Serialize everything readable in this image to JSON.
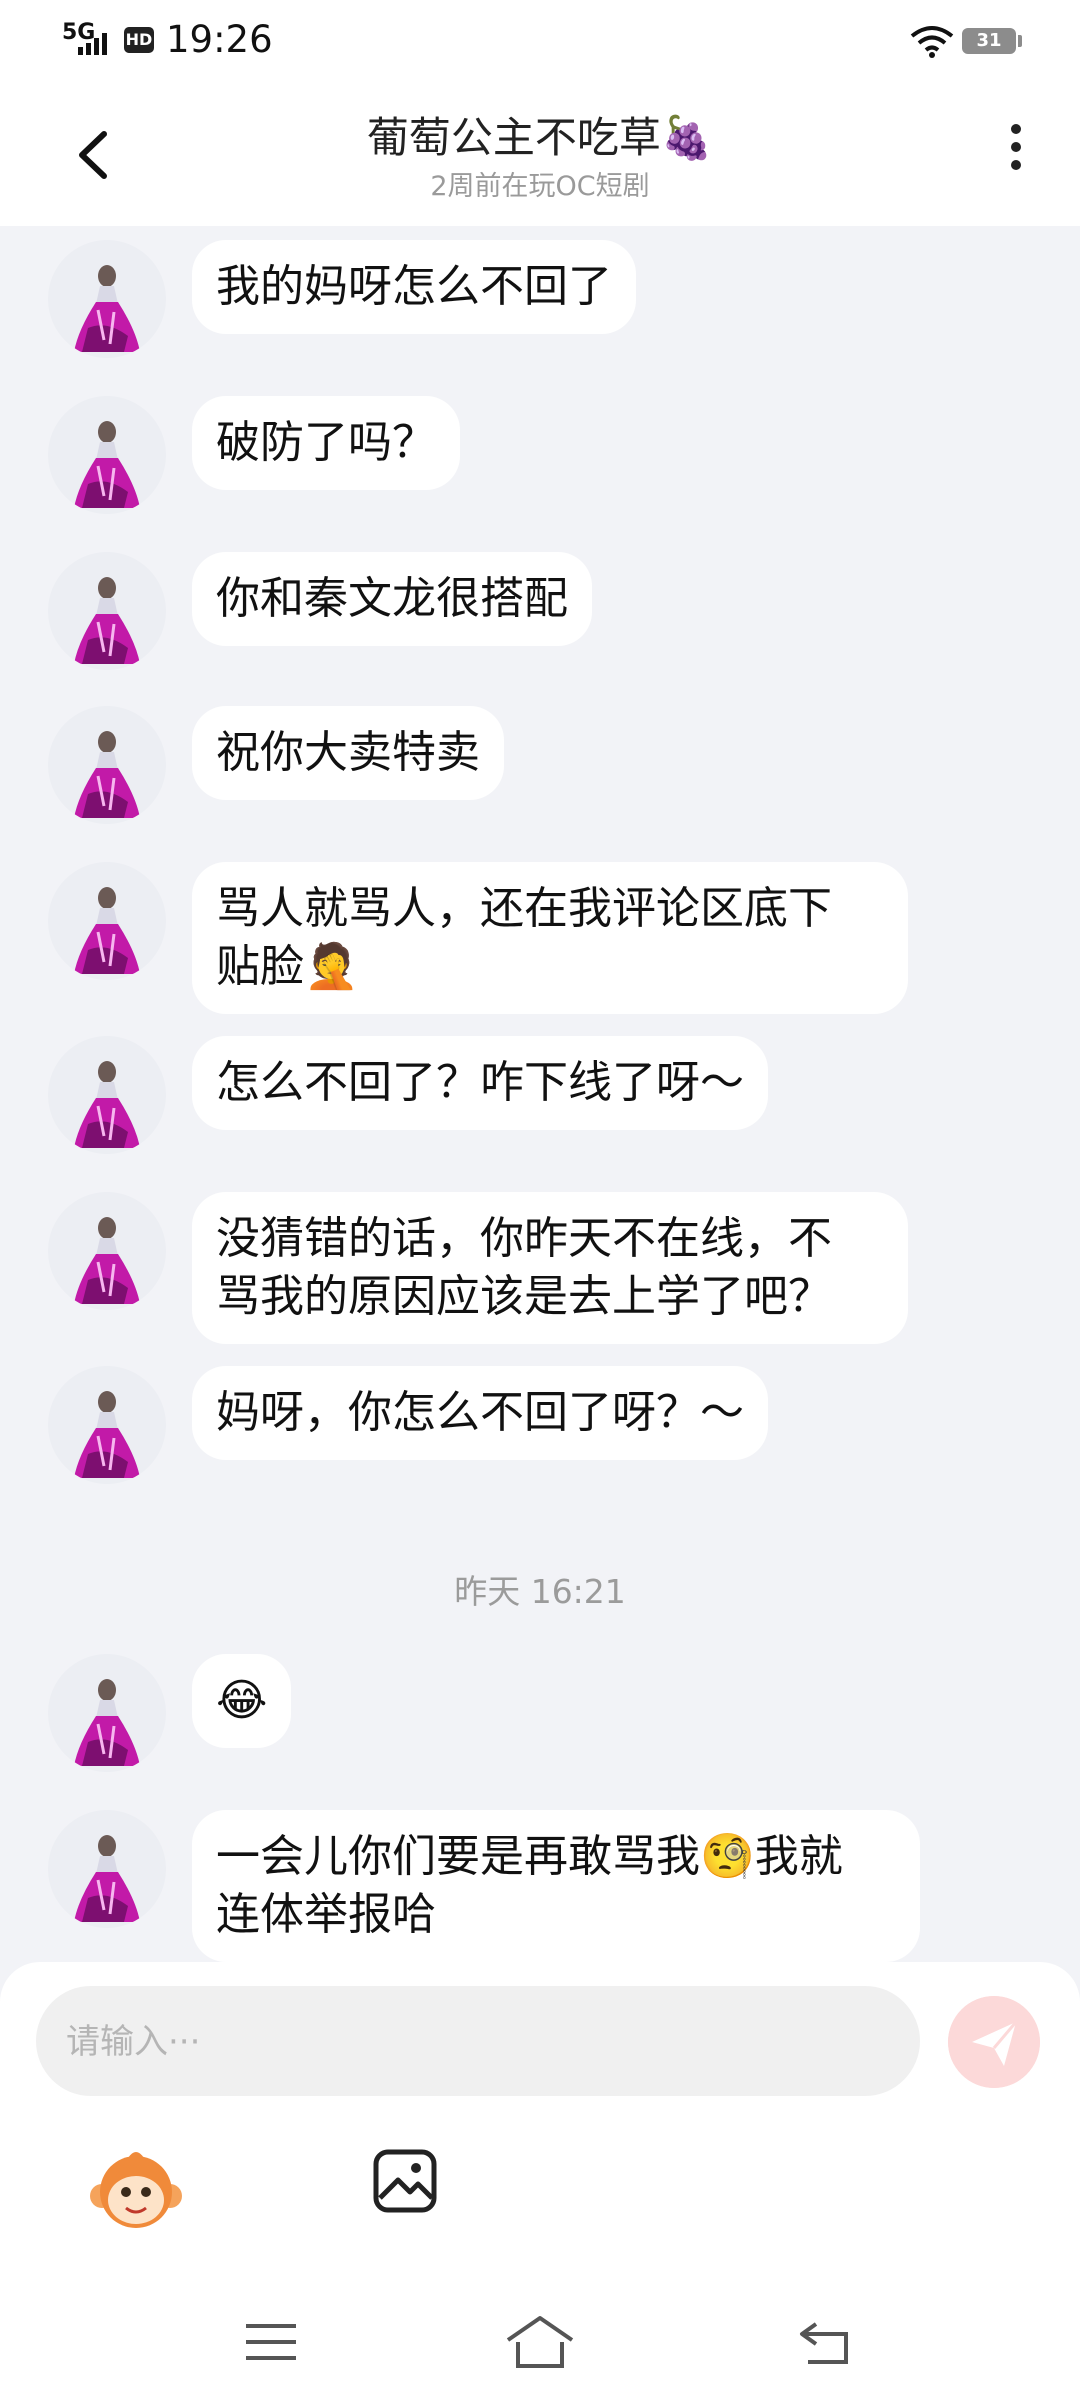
{
  "status_bar": {
    "network": "5G",
    "hd": "HD",
    "time": "19:26",
    "battery": "31"
  },
  "header": {
    "title": "葡萄公主不吃草🍇",
    "subtitle": "2周前在玩OC短剧",
    "back_icon": "chevron-left-icon",
    "more_icon": "more-vertical-icon"
  },
  "messages": [
    {
      "text": "我的妈呀怎么不回了"
    },
    {
      "text": "破防了吗？"
    },
    {
      "text": "你和秦文龙很搭配"
    },
    {
      "text": "祝你大卖特卖"
    },
    {
      "line1": "骂人就骂人，还在我评论区底下",
      "line2": "贴脸🤦"
    },
    {
      "text": "怎么不回了？咋下线了呀～"
    },
    {
      "line1": "没猜错的话，你昨天不在线，不",
      "line2": "骂我的原因应该是去上学了吧？"
    },
    {
      "text": "妈呀，你怎么不回了呀？～"
    },
    {
      "text": "😂"
    },
    {
      "line1": "一会儿你们要是再敢骂我🧐我就",
      "line2": "连体举报哈"
    }
  ],
  "timestamp": "昨天 16:21",
  "composer": {
    "placeholder": "请输入···",
    "send_icon": "send-icon",
    "emoji_icon": "monkey-sticker-icon",
    "image_icon": "image-icon"
  },
  "colors": {
    "background": "#f2f3f7",
    "bubble": "#ffffff",
    "send_button": "#fcd9d9",
    "avatar_dress": "#c21aa8"
  }
}
